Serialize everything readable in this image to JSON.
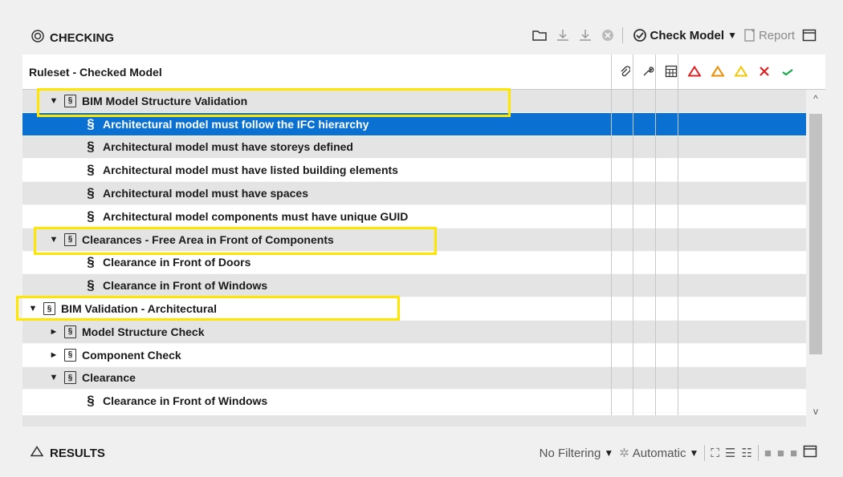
{
  "checking": {
    "title": "CHECKING",
    "check_model_label": "Check Model",
    "report_label": "Report"
  },
  "columns": {
    "header_label": "Ruleset - Checked Model",
    "icons": [
      "paperclip-icon",
      "wrench-icon",
      "table-icon",
      "triangle-red-icon",
      "triangle-orange-icon",
      "triangle-yellow-icon",
      "x-red-icon",
      "check-green-icon"
    ],
    "colors": {
      "critical": "#e02020",
      "moderate": "#f08c00",
      "low": "#f0c800",
      "rejected": "#e02020",
      "accepted": "#19a84a"
    }
  },
  "tree": {
    "rows": [
      {
        "label": "BIM Model Structure Validation",
        "type": "ruleset",
        "level": 1,
        "expanded": true,
        "style": "grey"
      },
      {
        "label": "Architectural model must follow the IFC hierarchy",
        "type": "rule",
        "level": 2,
        "style": "selected"
      },
      {
        "label": "Architectural model must have storeys defined",
        "type": "rule",
        "level": 2,
        "style": "grey"
      },
      {
        "label": "Architectural model must have listed building elements",
        "type": "rule",
        "level": 2,
        "style": "white"
      },
      {
        "label": "Architectural model must have spaces",
        "type": "rule",
        "level": 2,
        "style": "grey"
      },
      {
        "label": "Architectural model components must have unique GUID",
        "type": "rule",
        "level": 2,
        "style": "white"
      },
      {
        "label": "Clearances - Free Area in Front of Components",
        "type": "ruleset",
        "level": 1,
        "expanded": true,
        "style": "grey"
      },
      {
        "label": "Clearance in Front of Doors",
        "type": "rule",
        "level": 2,
        "style": "white"
      },
      {
        "label": "Clearance in Front of Windows",
        "type": "rule",
        "level": 2,
        "style": "grey"
      },
      {
        "label": "BIM Validation - Architectural",
        "type": "ruleset",
        "level": 0,
        "expanded": true,
        "style": "white"
      },
      {
        "label": "Model Structure Check",
        "type": "ruleset",
        "level": 1,
        "expanded": false,
        "style": "grey"
      },
      {
        "label": "Component Check",
        "type": "ruleset",
        "level": 1,
        "expanded": false,
        "style": "white"
      },
      {
        "label": "Clearance",
        "type": "ruleset",
        "level": 1,
        "expanded": true,
        "style": "grey"
      },
      {
        "label": "Clearance in Front of Windows",
        "type": "rule",
        "level": 2,
        "style": "white"
      }
    ]
  },
  "results": {
    "title": "RESULTS",
    "filtering_label": "No Filtering",
    "automatic_label": "Automatic"
  },
  "colors": {
    "selection": "#0a70d2",
    "highlight_box": "#ffe600",
    "row_alt": "#e4e4e4"
  }
}
